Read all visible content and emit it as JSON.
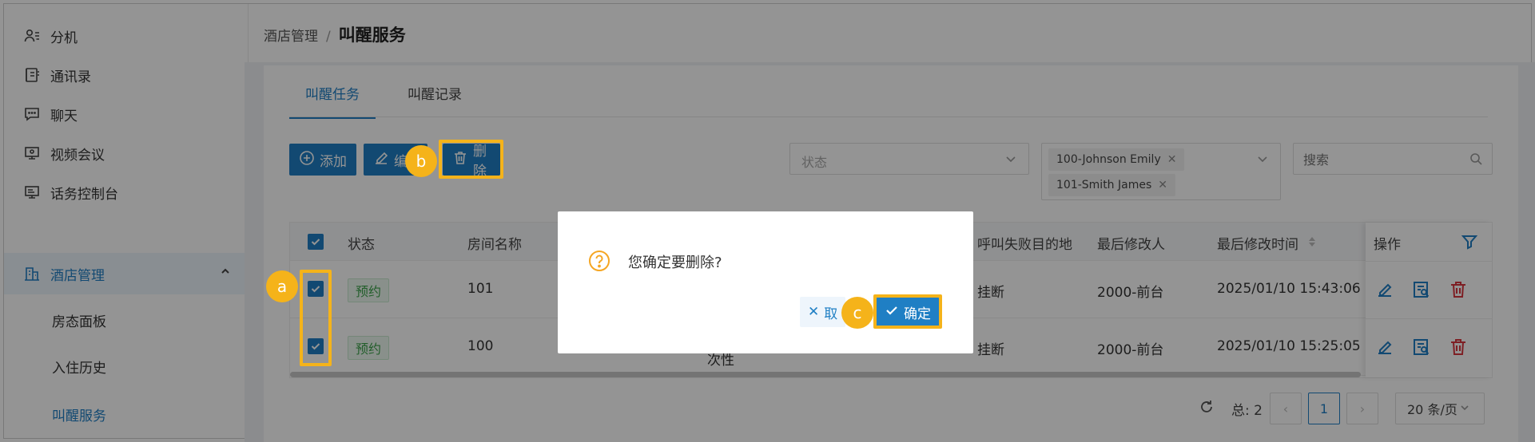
{
  "sidebar": {
    "items": [
      {
        "label": "分机",
        "icon": "user-list-icon"
      },
      {
        "label": "通讯录",
        "icon": "contacts-icon"
      },
      {
        "label": "聊天",
        "icon": "chat-icon"
      },
      {
        "label": "视频会议",
        "icon": "video-conference-icon"
      },
      {
        "label": "话务控制台",
        "icon": "operator-console-icon"
      },
      {
        "label": "酒店管理",
        "icon": "hotel-icon",
        "expanded": true
      },
      {
        "label": "房态面板"
      },
      {
        "label": "入住历史"
      },
      {
        "label": "叫醒服务",
        "active": true
      }
    ]
  },
  "breadcrumb": {
    "parent": "酒店管理",
    "separator": "/",
    "current": "叫醒服务"
  },
  "tabs": [
    {
      "label": "叫醒任务",
      "active": true
    },
    {
      "label": "叫醒记录"
    }
  ],
  "toolbar": {
    "add_label": "添加",
    "edit_label": "编",
    "delete_label": "删除"
  },
  "filters": {
    "status_placeholder": "状态",
    "extension_chips": [
      "100-Johnson Emily",
      "101-Smith James"
    ],
    "search_placeholder": "搜索"
  },
  "table": {
    "columns": [
      "状态",
      "房间名称",
      "呼叫失败目的地",
      "最后修改人",
      "最后修改时间",
      "操作"
    ],
    "rows": [
      {
        "status": "预约",
        "room": "101",
        "fail_dest": "挂断",
        "modifier": "2000-前台",
        "time": "2025/01/10 15:43:06"
      },
      {
        "status": "预约",
        "room": "100",
        "fail_dest": "挂断",
        "modifier": "2000-前台",
        "time": "2025/01/10 15:25:05",
        "partial_text": "次性"
      }
    ]
  },
  "pagination": {
    "total_label": "总: 2",
    "page": "1",
    "page_size": "20 条/页"
  },
  "dialog": {
    "message": "您确定要删除?",
    "cancel_label": "取",
    "confirm_label": "确定"
  },
  "callouts": {
    "a": "a",
    "b": "b",
    "c": "c"
  },
  "colors": {
    "accent": "#1f7fc4",
    "callout": "#f5b31a",
    "success": "#3ca34b",
    "danger": "#d9363e"
  }
}
